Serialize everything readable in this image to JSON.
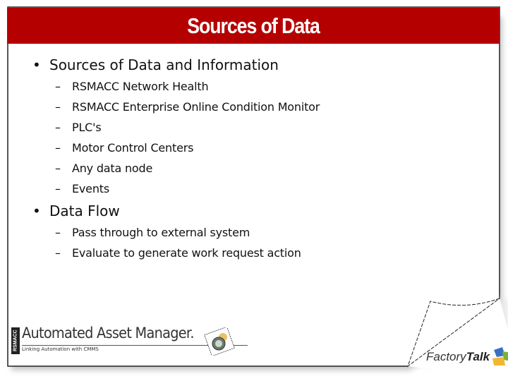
{
  "slide": {
    "title": "Sources of Data",
    "accent_color": "#b50000",
    "bullets": [
      {
        "text": "Sources of Data and Information",
        "marker": "•",
        "children": [
          {
            "marker": "–",
            "text": "RSMACC Network Health"
          },
          {
            "marker": "–",
            "text": "RSMACC Enterprise Online Condition Monitor"
          },
          {
            "marker": "–",
            "text": "PLC's"
          },
          {
            "marker": "–",
            "text": "Motor Control Centers"
          },
          {
            "marker": "–",
            "text": "Any data node"
          },
          {
            "marker": "–",
            "text": "Events"
          }
        ]
      },
      {
        "text": "Data Flow",
        "marker": "•",
        "children": [
          {
            "marker": "–",
            "text": "Pass through to external system"
          },
          {
            "marker": "–",
            "text": "Evaluate to generate work request action"
          }
        ]
      }
    ]
  },
  "footer": {
    "aam_badge": "RSMACC",
    "aam_title": "Automated Asset Manager.",
    "aam_subtitle": "Linking Automation with CMMS",
    "factorytalk_part1": "Factory",
    "factorytalk_part2": "Talk"
  }
}
